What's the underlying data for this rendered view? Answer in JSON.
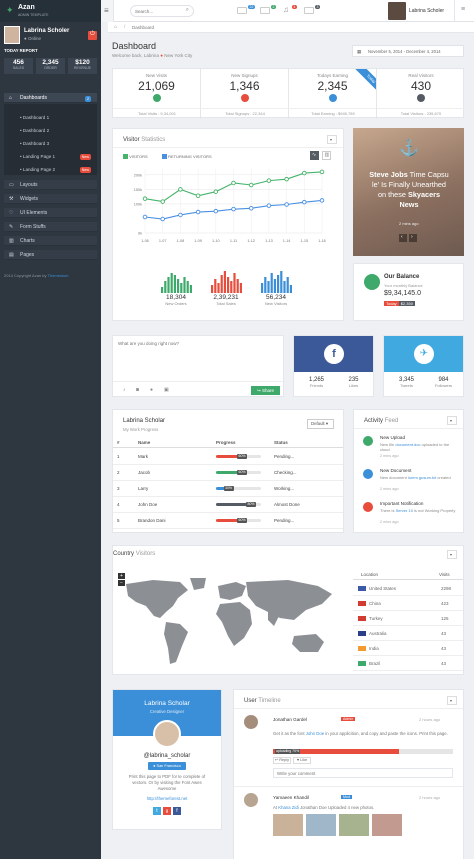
{
  "brand": {
    "name": "Azan",
    "subtitle": "ADMIN TEMPLATE"
  },
  "search": {
    "placeholder": "Search..."
  },
  "header": {
    "badges": [
      "22",
      "2",
      "4",
      "3"
    ],
    "user": "Labrina Scholer"
  },
  "profile": {
    "name": "Labrina Scholer",
    "status": "Online",
    "report_title": "TODAY REPORT",
    "stats": [
      {
        "value": "456",
        "label": "SALES"
      },
      {
        "value": "2,345",
        "label": "ORDER"
      },
      {
        "value": "$120",
        "label": "REVENUE"
      }
    ]
  },
  "nav": {
    "dashboards": "Dashboards",
    "dashboards_badge": "2",
    "sub": [
      {
        "label": "Dashboard 1"
      },
      {
        "label": "Dashboard 2"
      },
      {
        "label": "Dashboard 3"
      },
      {
        "label": "Landing Page 1",
        "badge": "New"
      },
      {
        "label": "Landing Page 2",
        "badge": "New"
      }
    ],
    "items": [
      "Layouts",
      "Widgets",
      "UI Elements",
      "Form Stuffs",
      "Charts",
      "Pages"
    ],
    "copyright": "2014 Copyright Azan by",
    "copyright_link": "Themesium"
  },
  "breadcrumb": {
    "current": "Dashboard"
  },
  "page": {
    "title": "Dashboard",
    "welcome": "Welcome back, Labrina",
    "location": "New York City",
    "date_range": "November 5, 2014 - December 4, 2014"
  },
  "stats": [
    {
      "label": "New Visits",
      "value": "21,069",
      "total": "Total Visits : 9,34,001",
      "color": "#3ea96a"
    },
    {
      "label": "New Signups",
      "value": "1,346",
      "total": "Total Signups : 22,344",
      "color": "#e74c3c"
    },
    {
      "label": "Todays Earning",
      "value": "2,345",
      "total": "Total Earning : $945,789",
      "color": "#3a8fd8",
      "ribbon": "Today"
    },
    {
      "label": "Real Visitors",
      "value": "430",
      "total": "Total Visitors : 235,670",
      "color": "#555b63"
    }
  ],
  "visitor_stats": {
    "title_bold": "Visitor",
    "title_rest": "Statistics",
    "legend": [
      "VISITORS",
      "RETURNING VISITORS"
    ],
    "mini": [
      {
        "value": "18,304",
        "label": "New Orders",
        "color": "#3ea96a"
      },
      {
        "value": "2,39,231",
        "label": "Total Sales",
        "color": "#e74c3c"
      },
      {
        "value": "56,234",
        "label": "New Visitors",
        "color": "#3a8fd8"
      }
    ]
  },
  "chart_data": {
    "type": "line",
    "x": [
      "1-06",
      "1-07",
      "1-08",
      "1-09",
      "1-10",
      "1-11",
      "1-12",
      "1-13",
      "1-14",
      "1-15",
      "1-16"
    ],
    "y_ticks": [
      "0k",
      "100k",
      "150k",
      "200k"
    ],
    "series": [
      {
        "name": "VISITORS",
        "color": "#45b36a",
        "values": [
          118,
          108,
          150,
          128,
          142,
          172,
          165,
          180,
          185,
          206,
          210
        ]
      },
      {
        "name": "RETURNING VISITORS",
        "color": "#4a90e2",
        "values": [
          55,
          48,
          62,
          72,
          75,
          82,
          85,
          94,
          98,
          106,
          112
        ]
      }
    ],
    "ylim": [
      0,
      220
    ]
  },
  "news": {
    "headline_1": "Steve Jobs",
    "headline_2": "Time Capsu",
    "headline_3": "le' Is Finally Unearthed",
    "headline_4": "on these",
    "headline_5": "Skyacers",
    "headline_6": "News",
    "meta": "2 mins ago"
  },
  "balance": {
    "title": "Our Balance",
    "subtitle": "Your monthly Balance",
    "value": "$9,34,145.0",
    "tag": "Today",
    "today": "$2,350"
  },
  "status_box": {
    "placeholder": "What are you doing right now?",
    "share": "Share"
  },
  "facebook": {
    "stats": [
      {
        "value": "1,265",
        "label": "Friends"
      },
      {
        "value": "235",
        "label": "Likes"
      }
    ]
  },
  "twitter": {
    "stats": [
      {
        "value": "3,345",
        "label": "Tweets"
      },
      {
        "value": "984",
        "label": "Followers"
      }
    ]
  },
  "progress": {
    "title": "Labrina Scholar",
    "subtitle": "My Work Progress",
    "dropdown": "Default",
    "headers": [
      "#",
      "Name",
      "Progress",
      "Status"
    ],
    "rows": [
      {
        "n": "1",
        "name": "Mark",
        "pct": "60%",
        "status": "Pending...",
        "color": "#e74c3c",
        "frac": 0.6
      },
      {
        "n": "2",
        "name": "Jacob",
        "pct": "60%",
        "status": "Checking...",
        "color": "#3ea96a",
        "frac": 0.6
      },
      {
        "n": "3",
        "name": "Larry",
        "pct": "30%",
        "status": "Working...",
        "color": "#3a8fd8",
        "frac": 0.3
      },
      {
        "n": "4",
        "name": "John Doe",
        "pct": "80%",
        "status": "Almost Done",
        "color": "#555b63",
        "frac": 0.8
      },
      {
        "n": "5",
        "name": "Brandon Dani",
        "pct": "60%",
        "status": "Pending...",
        "color": "#e74c3c",
        "frac": 0.6
      }
    ]
  },
  "activity": {
    "title_bold": "Activity",
    "title_rest": "Feed",
    "items": [
      {
        "title": "New Upload",
        "text": "New file",
        "link": "document.doc",
        "text2": "uploaded to the cloud",
        "time": "2 mins ago",
        "color": "#3ea96a"
      },
      {
        "title": "New Document",
        "text": "New document",
        "link": "lorem gusum.txt",
        "text2": "created",
        "time": "2 mins ago",
        "color": "#3a8fd8"
      },
      {
        "title": "Important Notification",
        "text": "There is",
        "link": "Server 10",
        "text2": "is not Working Properly",
        "time": "2 mins ago",
        "color": "#e74c3c"
      }
    ]
  },
  "country": {
    "title_bold": "Country",
    "title_rest": "Visitors",
    "headers": [
      "Location",
      "Visits"
    ],
    "rows": [
      {
        "name": "United States",
        "visits": "2298"
      },
      {
        "name": "China",
        "visits": "423"
      },
      {
        "name": "Turkey",
        "visits": "125"
      },
      {
        "name": "Australia",
        "visits": "43"
      },
      {
        "name": "India",
        "visits": "43"
      },
      {
        "name": "Brazil",
        "visits": "43"
      }
    ]
  },
  "profile_card": {
    "name": "Labrina Scholar",
    "role": "Creative Designer",
    "handle": "@labrina_scholar",
    "location": "San Francisco",
    "bio_1": "Print this page to PDF for te complete of",
    "bio_2": "vectors. Or by visiting the Font Awes",
    "bio_3": "Awesome",
    "url": "http://themeforest.net"
  },
  "timeline": {
    "title_bold": "User",
    "title_rest": "Timeline",
    "entries": [
      {
        "user": "Jonathan Gardel",
        "tag": "Admin",
        "time": "2 hours ago",
        "text_1": "Get it as the font",
        "link": "John Doe",
        "text_2": "in your applicition, and copy and paste the icons. Print this page.",
        "progress_label": "uploading",
        "progress": "70%",
        "actions": [
          "Reply",
          "Like"
        ],
        "comment": "Write your comment"
      },
      {
        "user": "Yamaeen Khandil",
        "tag": "Mod",
        "time": "2 hours ago",
        "text_1": "At",
        "link": "Khana Zidi",
        "text_2": "Jonathan Doe Uploaded 4 new photos."
      }
    ]
  }
}
